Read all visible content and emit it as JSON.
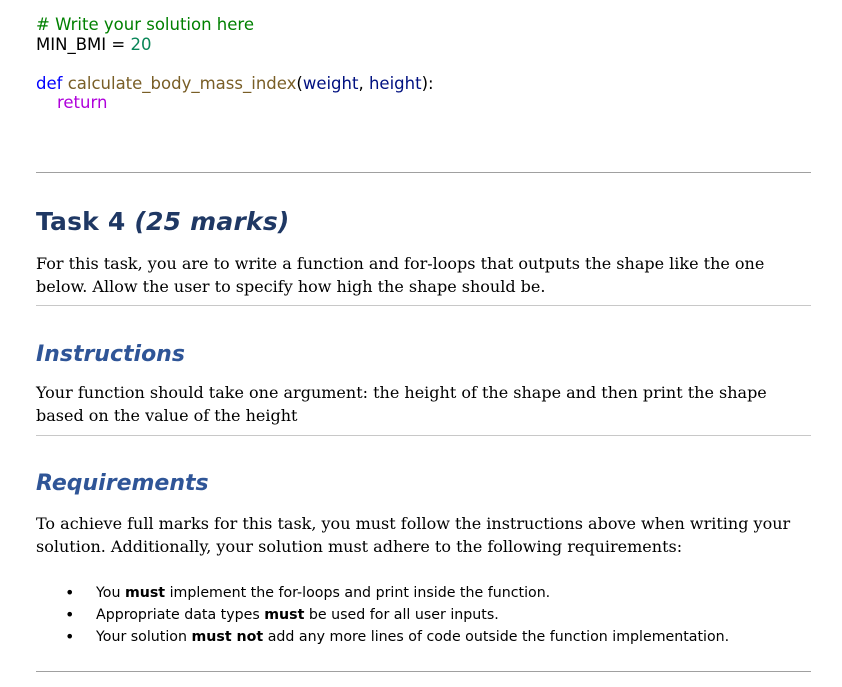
{
  "code": {
    "comment": "# Write your solution here",
    "const_name": "MIN_BMI",
    "const_op": " = ",
    "const_value": "20",
    "def_keyword": "def",
    "func_name": "calculate_body_mass_index",
    "paren_open": "(",
    "param1": "weight",
    "comma": ", ",
    "param2": "height",
    "paren_close": "):",
    "return_keyword": "return"
  },
  "task": {
    "title": "Task 4 ",
    "marks": "(25 marks)",
    "description": "For this task, you are to write a function and for-loops that outputs the shape like the one below. Allow the user to specify how high the shape should be."
  },
  "instructions": {
    "heading": "Instructions",
    "text": "Your function should take one argument: the height of the shape and then print the shape based on the value of the height"
  },
  "requirements": {
    "heading": "Requirements",
    "text": "To achieve full marks for this task, you must follow the instructions above when writing your solution. Additionally, your solution must adhere to the following requirements:",
    "bullet_char": "•",
    "items": [
      {
        "pre": "You ",
        "bold": "must",
        "post": " implement the for-loops and print inside the function."
      },
      {
        "pre": "Appropriate data types ",
        "bold": "must",
        "post": " be used for all user inputs."
      },
      {
        "pre": "Your solution ",
        "bold": "must not",
        "post": " add any more lines of code outside the function implementation."
      }
    ]
  }
}
